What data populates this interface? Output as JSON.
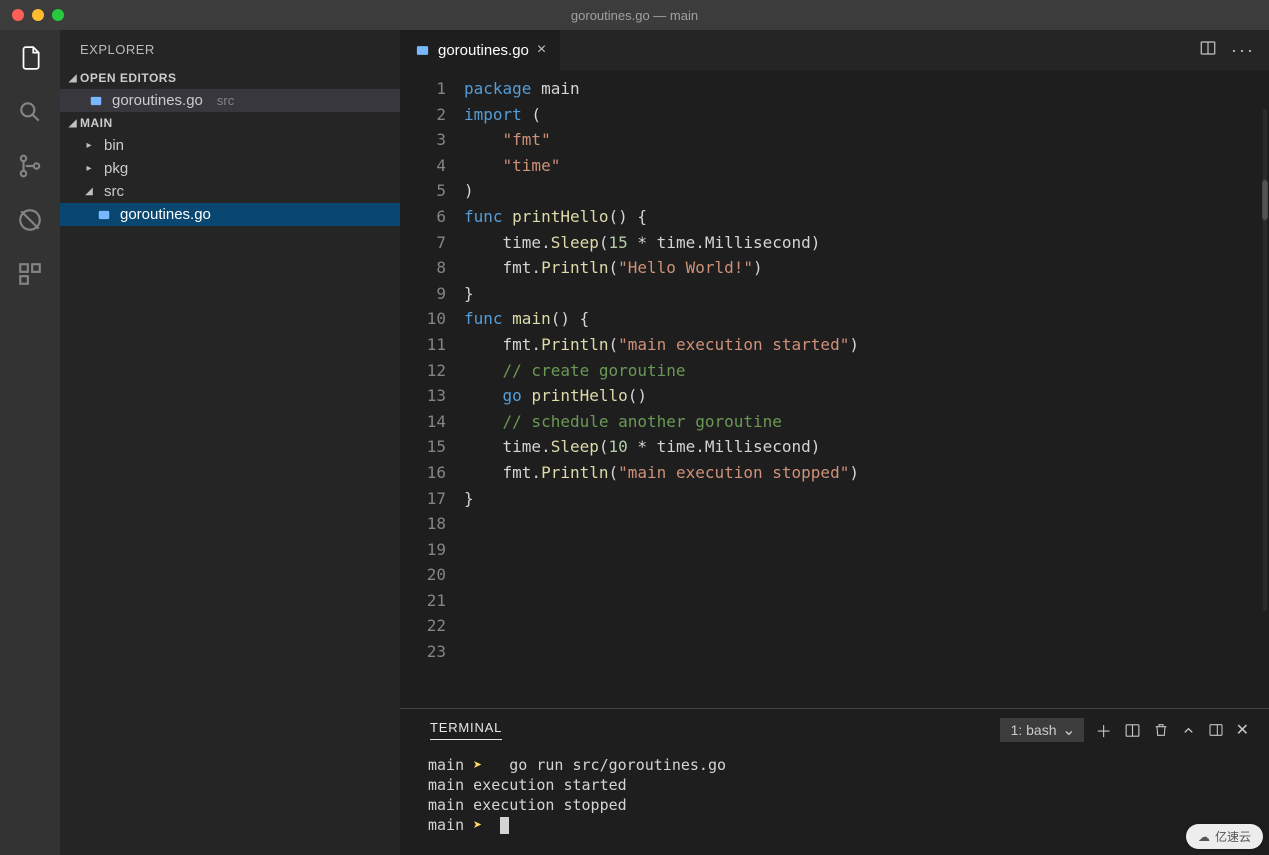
{
  "window": {
    "title": "goroutines.go — main"
  },
  "activity": {
    "items": [
      {
        "name": "files-icon",
        "active": true
      },
      {
        "name": "search-icon",
        "active": false
      },
      {
        "name": "source-control-icon",
        "active": false
      },
      {
        "name": "debug-icon",
        "active": false
      },
      {
        "name": "extensions-icon",
        "active": false
      }
    ]
  },
  "sidebar": {
    "title": "EXPLORER",
    "open_editors_label": "OPEN EDITORS",
    "open_editors": [
      {
        "name": "goroutines.go",
        "dir": "src",
        "active": true
      }
    ],
    "workspace_label": "MAIN",
    "tree": [
      {
        "type": "folder",
        "name": "bin",
        "expanded": false,
        "depth": 1
      },
      {
        "type": "folder",
        "name": "pkg",
        "expanded": false,
        "depth": 1
      },
      {
        "type": "folder",
        "name": "src",
        "expanded": true,
        "depth": 1
      },
      {
        "type": "file",
        "name": "goroutines.go",
        "depth": 2,
        "selected": true
      }
    ]
  },
  "tabs": [
    {
      "label": "goroutines.go",
      "icon": "go-file-icon",
      "active": true
    }
  ],
  "editor_actions": {
    "split": "split-editor-icon",
    "more": "more-icon"
  },
  "code": {
    "lines": [
      [
        {
          "c": "kw",
          "t": "package"
        },
        {
          "c": "",
          "t": " main"
        }
      ],
      [
        {
          "c": "",
          "t": ""
        }
      ],
      [
        {
          "c": "kw",
          "t": "import"
        },
        {
          "c": "",
          "t": " ("
        }
      ],
      [
        {
          "c": "",
          "t": "    "
        },
        {
          "c": "str",
          "t": "\"fmt\""
        }
      ],
      [
        {
          "c": "",
          "t": "    "
        },
        {
          "c": "str",
          "t": "\"time\""
        }
      ],
      [
        {
          "c": "",
          "t": ")"
        }
      ],
      [
        {
          "c": "",
          "t": ""
        }
      ],
      [
        {
          "c": "kw",
          "t": "func"
        },
        {
          "c": "",
          "t": " "
        },
        {
          "c": "fn",
          "t": "printHello"
        },
        {
          "c": "",
          "t": "() {"
        }
      ],
      [
        {
          "c": "",
          "t": "    time."
        },
        {
          "c": "fn",
          "t": "Sleep"
        },
        {
          "c": "",
          "t": "("
        },
        {
          "c": "num",
          "t": "15"
        },
        {
          "c": "",
          "t": " * time.Millisecond)"
        }
      ],
      [
        {
          "c": "",
          "t": "    fmt."
        },
        {
          "c": "fn",
          "t": "Println"
        },
        {
          "c": "",
          "t": "("
        },
        {
          "c": "str",
          "t": "\"Hello World!\""
        },
        {
          "c": "",
          "t": ")"
        }
      ],
      [
        {
          "c": "",
          "t": "}"
        }
      ],
      [
        {
          "c": "",
          "t": ""
        }
      ],
      [
        {
          "c": "kw",
          "t": "func"
        },
        {
          "c": "",
          "t": " "
        },
        {
          "c": "fn",
          "t": "main"
        },
        {
          "c": "",
          "t": "() {"
        }
      ],
      [
        {
          "c": "",
          "t": "    fmt."
        },
        {
          "c": "fn",
          "t": "Println"
        },
        {
          "c": "",
          "t": "("
        },
        {
          "c": "str",
          "t": "\"main execution started\""
        },
        {
          "c": "",
          "t": ")"
        }
      ],
      [
        {
          "c": "",
          "t": ""
        }
      ],
      [
        {
          "c": "",
          "t": "    "
        },
        {
          "c": "cm",
          "t": "// create goroutine"
        }
      ],
      [
        {
          "c": "",
          "t": "    "
        },
        {
          "c": "kw",
          "t": "go"
        },
        {
          "c": "",
          "t": " "
        },
        {
          "c": "fn",
          "t": "printHello"
        },
        {
          "c": "",
          "t": "()"
        }
      ],
      [
        {
          "c": "",
          "t": ""
        }
      ],
      [
        {
          "c": "",
          "t": "    "
        },
        {
          "c": "cm",
          "t": "// schedule another goroutine"
        }
      ],
      [
        {
          "c": "",
          "t": "    time."
        },
        {
          "c": "fn",
          "t": "Sleep"
        },
        {
          "c": "",
          "t": "("
        },
        {
          "c": "num",
          "t": "10"
        },
        {
          "c": "",
          "t": " * time.Millisecond)"
        }
      ],
      [
        {
          "c": "",
          "t": "    fmt."
        },
        {
          "c": "fn",
          "t": "Println"
        },
        {
          "c": "",
          "t": "("
        },
        {
          "c": "str",
          "t": "\"main execution stopped\""
        },
        {
          "c": "",
          "t": ")"
        }
      ],
      [
        {
          "c": "",
          "t": "}"
        }
      ],
      [
        {
          "c": "",
          "t": ""
        }
      ]
    ]
  },
  "terminal": {
    "title": "TERMINAL",
    "select": "1: bash",
    "actions": [
      "new-terminal-icon",
      "split-terminal-icon",
      "kill-terminal-icon",
      "collapse-icon",
      "maximize-icon",
      "close-panel-icon"
    ],
    "lines": [
      {
        "prompt": "main",
        "sep": "➤",
        "cmd": " go run src/goroutines.go"
      },
      {
        "text": "main execution started"
      },
      {
        "text": "main execution stopped"
      },
      {
        "prompt": "main",
        "sep": "➤",
        "cursor": true
      }
    ]
  },
  "watermark": "亿速云"
}
